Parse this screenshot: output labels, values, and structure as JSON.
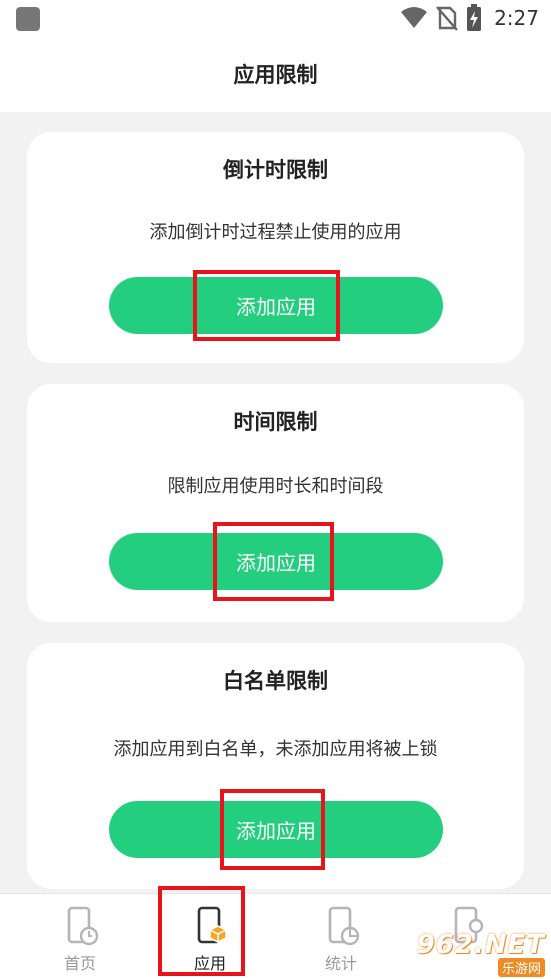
{
  "status_bar": {
    "time": "2:27",
    "icons": [
      "notification-square-icon",
      "wifi-icon",
      "no-sim-icon",
      "battery-charging-icon"
    ]
  },
  "header": {
    "title": "应用限制"
  },
  "cards": [
    {
      "title": "倒计时限制",
      "description": "添加倒计时过程禁止使用的应用",
      "button_label": "添加应用"
    },
    {
      "title": "时间限制",
      "description": "限制应用使用时长和时间段",
      "button_label": "添加应用"
    },
    {
      "title": "白名单限制",
      "description": "添加应用到白名单，未添加应用将被上锁",
      "button_label": "添加应用"
    }
  ],
  "bottom_nav": {
    "items": [
      {
        "label": "首页",
        "icon": "phone-timer-icon",
        "active": false
      },
      {
        "label": "应用",
        "icon": "phone-app-icon",
        "active": true
      },
      {
        "label": "统计",
        "icon": "phone-chart-icon",
        "active": false
      },
      {
        "label": "",
        "icon": "phone-settings-icon",
        "active": false
      }
    ]
  },
  "watermark": {
    "logo": "962.NET",
    "subtitle": "乐游网"
  },
  "colors": {
    "accent_green": "#23cf7f",
    "highlight_red": "#e8141b",
    "app_orange": "#f5a623",
    "background": "#f2f2f2"
  }
}
